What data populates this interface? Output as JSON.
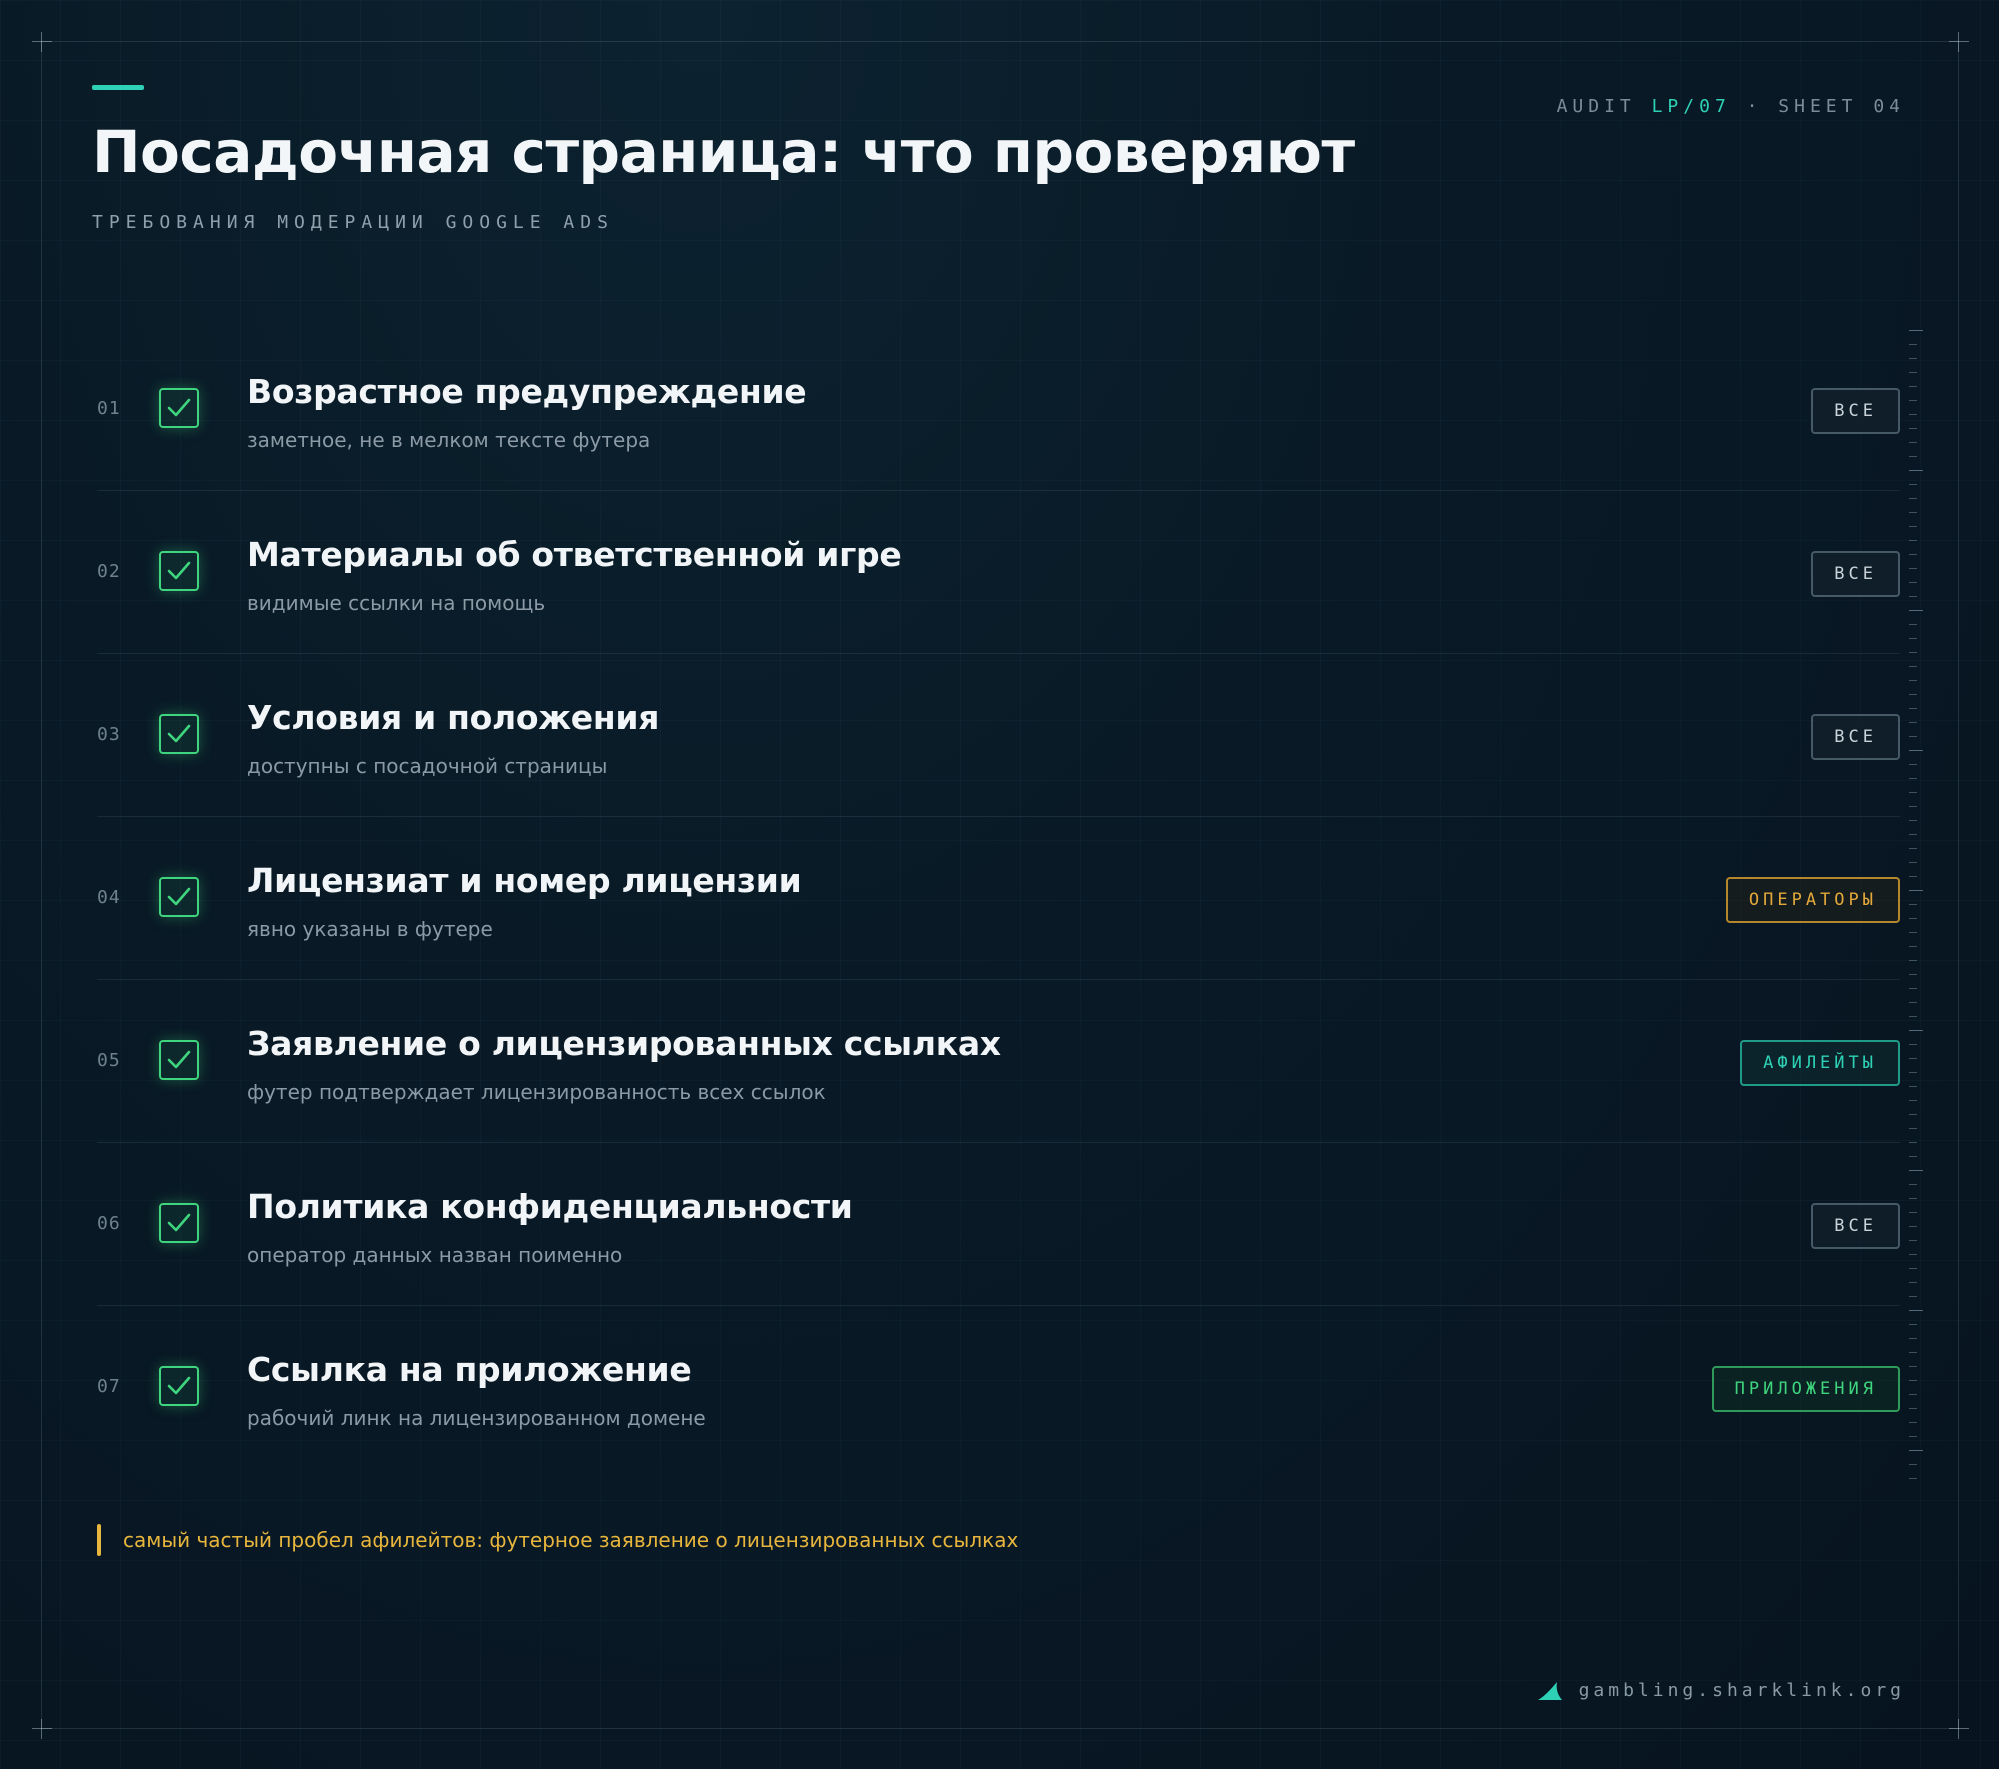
{
  "header": {
    "title": "Посадочная страница: что проверяют",
    "subtitle": "ТРЕБОВАНИЯ МОДЕРАЦИИ GOOGLE ADS",
    "audit_prefix": "AUDIT ",
    "audit_code": "LP/07",
    "audit_suffix": " · SHEET 04"
  },
  "items": [
    {
      "num": "01",
      "title": "Возрастное предупреждение",
      "desc": "заметное, не в мелком тексте футера",
      "tag": "ВСЕ",
      "tag_type": "all"
    },
    {
      "num": "02",
      "title": "Материалы об ответственной игре",
      "desc": "видимые ссылки на помощь",
      "tag": "ВСЕ",
      "tag_type": "all"
    },
    {
      "num": "03",
      "title": "Условия и положения",
      "desc": "доступны с посадочной страницы",
      "tag": "ВСЕ",
      "tag_type": "all"
    },
    {
      "num": "04",
      "title": "Лицензиат и номер лицензии",
      "desc": "явно указаны в футере",
      "tag": "ОПЕРАТОРЫ",
      "tag_type": "operators"
    },
    {
      "num": "05",
      "title": "Заявление о лицензированных ссылках",
      "desc": "футер подтверждает лицензированность всех ссылок",
      "tag": "АФИЛЕЙТЫ",
      "tag_type": "affiliates"
    },
    {
      "num": "06",
      "title": "Политика конфиденциальности",
      "desc": "оператор данных назван поименно",
      "tag": "ВСЕ",
      "tag_type": "all"
    },
    {
      "num": "07",
      "title": "Ссылка на приложение",
      "desc": "рабочий линк на лицензированном домене",
      "tag": "ПРИЛОЖЕНИЯ",
      "tag_type": "apps"
    }
  ],
  "note": "самый частый пробел афилейтов: футерное заявление о лицензированных ссылках",
  "footer": {
    "url": "gambling.sharklink.org"
  },
  "colors": {
    "accent": "#2fd1b6",
    "check": "#3ed57e",
    "warning": "#e8b63d",
    "operators": "#e3a83a"
  },
  "icons": {
    "check": "check-icon",
    "brand": "shark-fin-icon"
  }
}
